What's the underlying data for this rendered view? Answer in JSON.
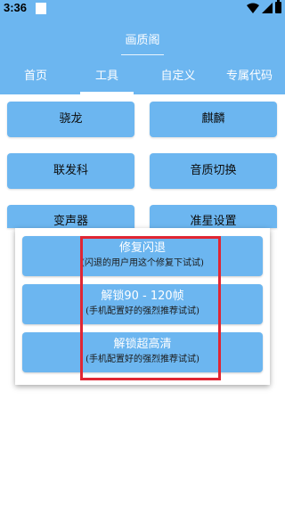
{
  "status_bar": {
    "time": "3:36"
  },
  "header": {
    "title": "画质阁",
    "tabs": [
      {
        "label": "首页"
      },
      {
        "label": "工具",
        "active": true
      },
      {
        "label": "自定义"
      },
      {
        "label": "专属代码"
      }
    ]
  },
  "grid": {
    "buttons": [
      {
        "label": "骁龙"
      },
      {
        "label": "麒麟"
      },
      {
        "label": "联发科"
      },
      {
        "label": "音质切换"
      },
      {
        "label": "变声器"
      },
      {
        "label": "准星设置"
      }
    ]
  },
  "dialog": {
    "actions": [
      {
        "title": "修复闪退",
        "subtitle": "(闪退的用户用这个修复下试试)"
      },
      {
        "title": "解锁90 - 120帧",
        "subtitle": "(手机配置好的强烈推荐试试)"
      },
      {
        "title": "解锁超高清",
        "subtitle": "(手机配置好的强烈推荐试试)"
      }
    ]
  },
  "colors": {
    "primary": "#6cb6f0",
    "highlight": "#e02633",
    "background": "#ffffff"
  }
}
